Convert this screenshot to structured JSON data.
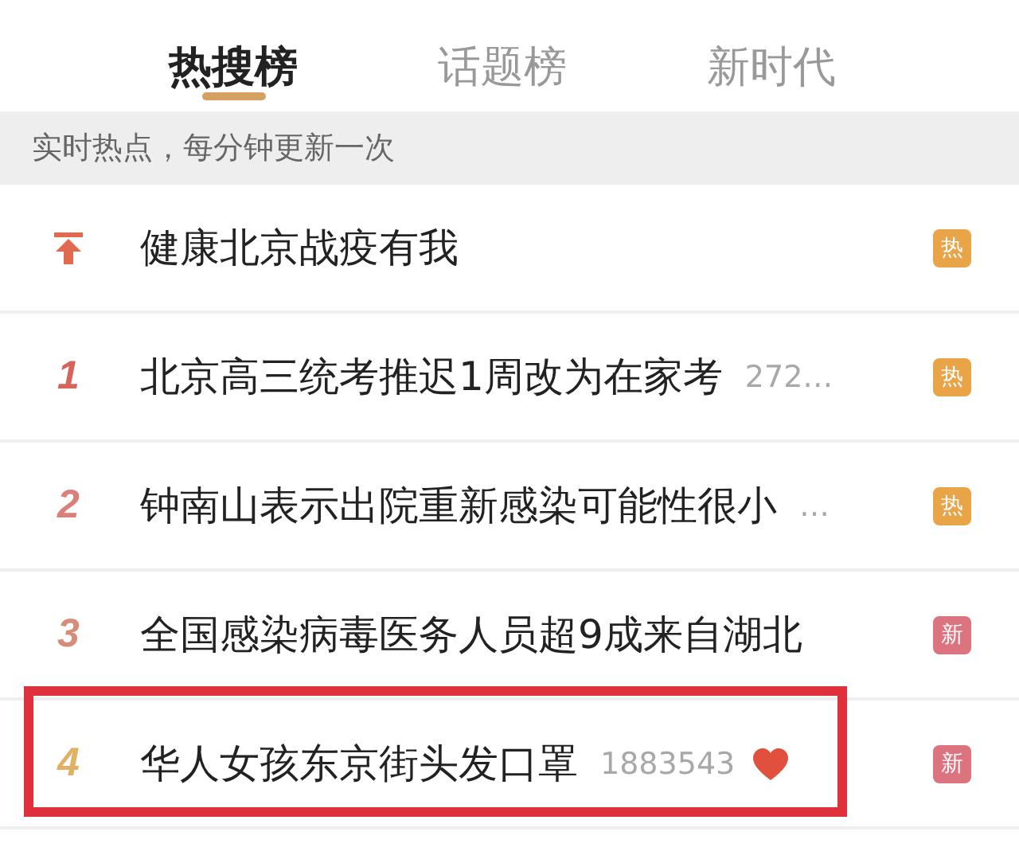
{
  "tabs": [
    {
      "label": "热搜榜",
      "selected": true
    },
    {
      "label": "话题榜",
      "selected": false
    },
    {
      "label": "新时代",
      "selected": false
    }
  ],
  "notice": "实时热点，每分钟更新一次",
  "rows": [
    {
      "kind": "pinned",
      "title": "健康北京战疫有我",
      "badge": {
        "text": "热",
        "kind": "hot"
      },
      "highlighted": false
    },
    {
      "kind": "ranked",
      "rank": "1",
      "color": "#d4645c",
      "title": "北京高三统考推迟1周改为在家考",
      "count": "272…",
      "badge": {
        "text": "热",
        "kind": "hot"
      },
      "highlighted": false
    },
    {
      "kind": "ranked",
      "rank": "2",
      "color": "#d98078",
      "title": "钟南山表示出院重新感染可能性很小",
      "count": "…",
      "badge": {
        "text": "热",
        "kind": "hot"
      },
      "highlighted": false
    },
    {
      "kind": "ranked",
      "rank": "3",
      "color": "#d68c78",
      "title": "全国感染病毒医务人员超9成来自湖北",
      "badge": {
        "text": "新",
        "kind": "new"
      },
      "highlighted": false
    },
    {
      "kind": "ranked",
      "rank": "4",
      "color": "#e0b064",
      "title": "华人女孩东京街头发口罩",
      "count": "1883543",
      "liked": true,
      "badge": {
        "text": "新",
        "kind": "new"
      },
      "highlighted": true
    }
  ]
}
